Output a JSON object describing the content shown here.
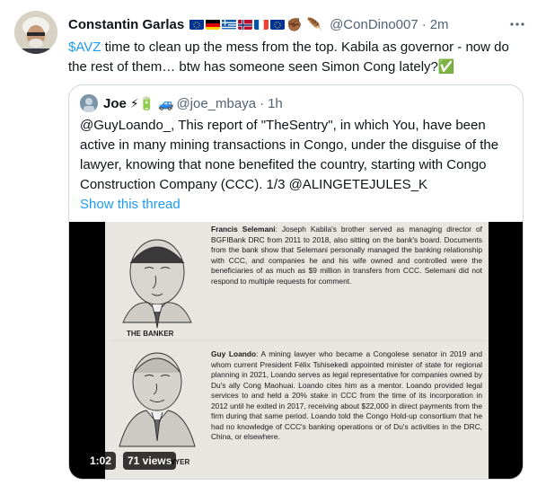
{
  "tweet": {
    "author_name": "Constantin Garlas",
    "author_flags": [
      "eu-flag",
      "germany-flag",
      "greece-flag",
      "norway-flag",
      "france-flag",
      "eu-flag"
    ],
    "author_emoji": [
      "✊🏾",
      "🪶"
    ],
    "author_handle": "@ConDino007",
    "separator": "·",
    "time": "2m",
    "more_icon": "more-icon",
    "cashtag": "$AVZ",
    "text": " time to clean up the mess from the top. Kabila as governor  - now do the rest of them… btw has someone seen Simon Cong lately?",
    "text_end_emoji": "✅"
  },
  "quoted": {
    "name": "Joe",
    "name_emoji": "⚡🔋 🚙",
    "handle": "@joe_mbaya",
    "separator": "·",
    "time": "1h",
    "text": "@GuyLoando_, This report of \"TheSentry\", in which You, have been active in many mining transactions in Congo, under the disguise of the lawyer, knowing that none benefited the country, starting with Congo Construction Company (CCC). 1/3 @ALINGETEJULES_K",
    "show_thread": "Show this thread",
    "media": {
      "caption_banker": "THE BANKER",
      "caption_lawyer": "LAWYER",
      "bio1_name": "Francis Selemani",
      "bio1_text": ": Joseph Kabila's brother served as managing director of BGFIBank DRC from 2011 to 2018, also sitting on the bank's board. Documents from the bank show that Selemani personally managed the banking relationship with CCC, and companies he and his wife owned and controlled were the beneficiaries of as much as $9 million in transfers from CCC. Selemani did not respond to multiple requests for comment.",
      "bio2_name": "Guy Loando",
      "bio2_text": ": A mining lawyer who became a Congolese senator in 2019 and whom current President Félix Tshisekedi appointed minister of state for regional planning in 2021, Loando serves as legal representative for companies owned by Du's ally Cong Maohuai. Loando cites him as a mentor. Loando provided legal services to and held a 20% stake in CCC from the time of its incorporation in 2012 until he exited in 2017, receiving about $22,000 in direct payments from the firm during that same period. Loando told the Congo Hold-up consortium that he had no knowledge of CCC's banking operations or of Du's activities in the DRC, China, or elsewhere.",
      "duration": "1:02",
      "views": "71 views"
    }
  }
}
